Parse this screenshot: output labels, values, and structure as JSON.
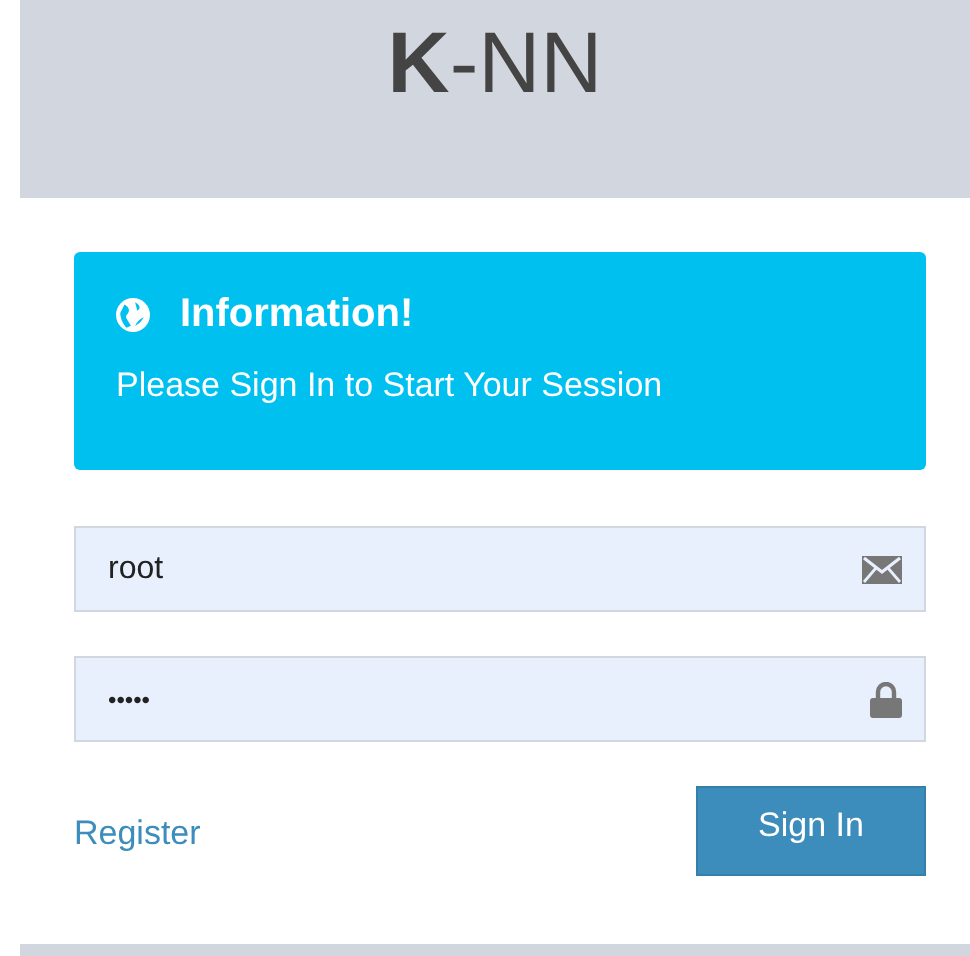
{
  "header": {
    "title": "**K**-NN"
  },
  "alert": {
    "title": "Information!",
    "message": "Please Sign In to Start Your Session"
  },
  "fields": [
    {
      "kind": "email",
      "value": "root"
    },
    {
      "kind": "password",
      "value": "•••••"
    }
  ],
  "register_link": "Register",
  "sign_in_button": "Sign In"
}
